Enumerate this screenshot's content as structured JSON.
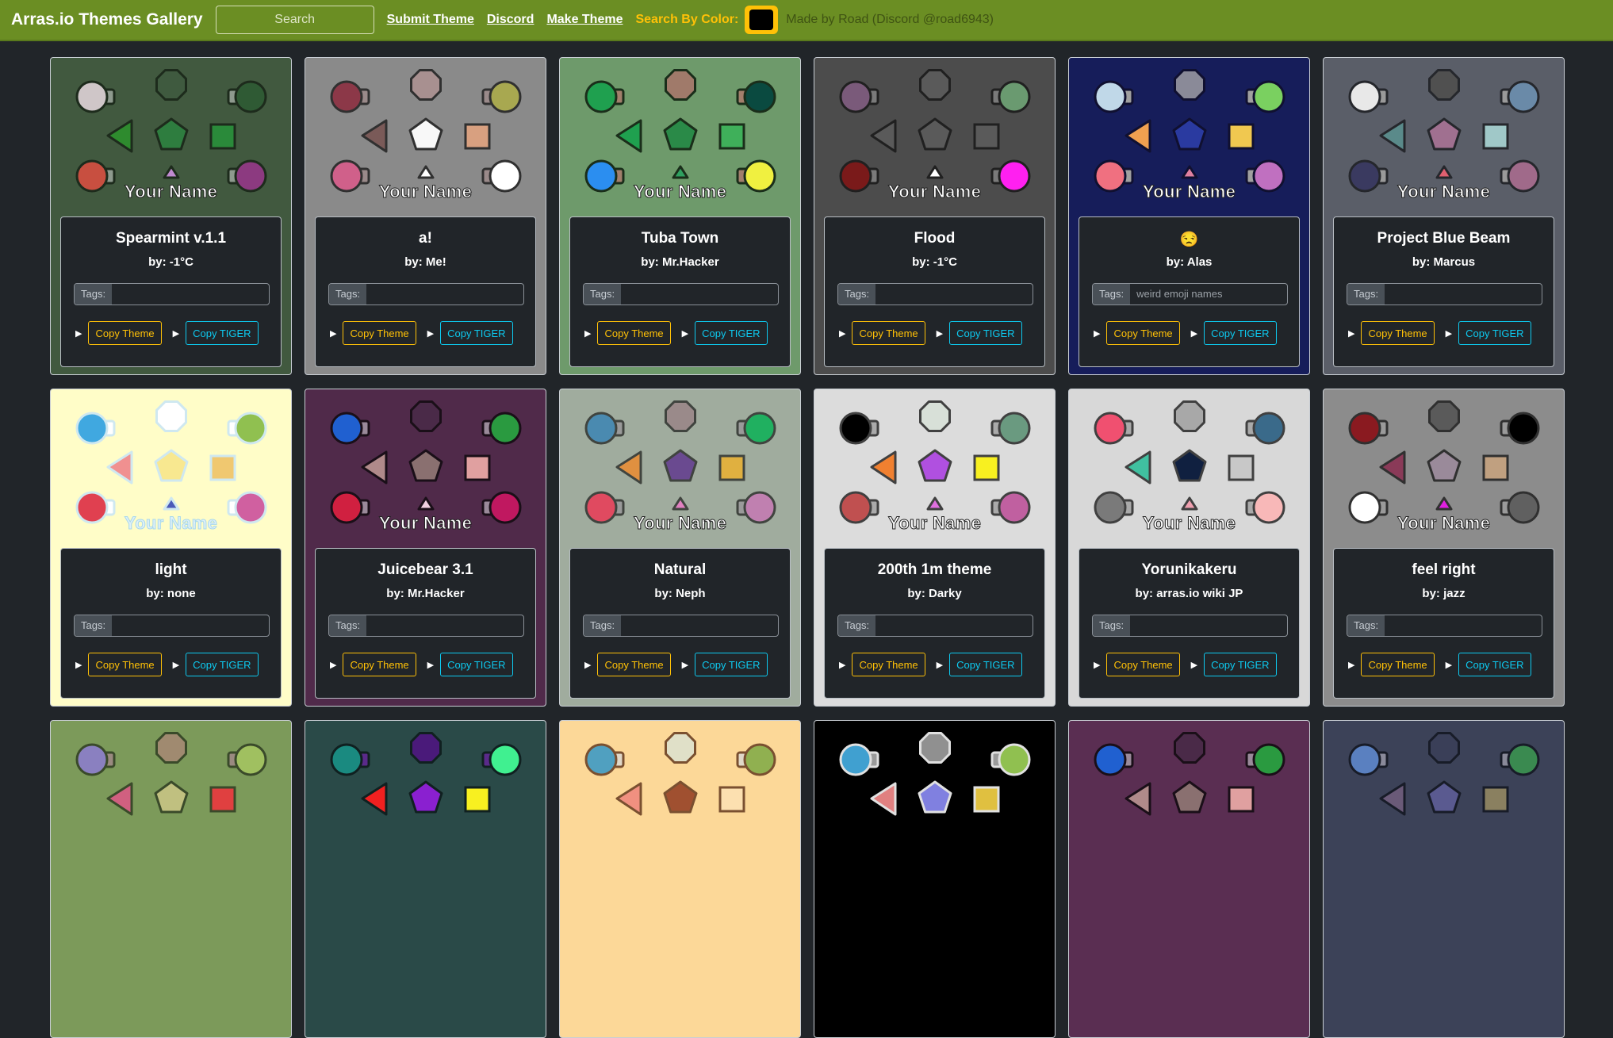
{
  "navbar": {
    "brand": "Arras.io Themes Gallery",
    "search_placeholder": "Search",
    "links": [
      "Submit Theme",
      "Discord",
      "Make Theme"
    ],
    "color_label": "Search By Color:",
    "color_value": "#000000",
    "credit": "Made by Road (Discord @road6943)"
  },
  "labels": {
    "your_name": "Your Name",
    "tags": "Tags:",
    "copy_theme": "Copy Theme",
    "copy_tiger": "Copy TIGER"
  },
  "themes": [
    {
      "name": "Spearmint v.1.1",
      "author": "by: -1°C",
      "tags": "",
      "bg": "#41593f",
      "barrel": "#8e9a8e",
      "border": "#1d2b1c",
      "colors": [
        "#cfc6c8",
        "#3f5a3f",
        "#2f5a34",
        "#2e8b2e",
        "#2e7d3f",
        "#2a8a3a",
        "#c84f40",
        "#c08ad0",
        "#8c3a80"
      ]
    },
    {
      "name": "a!",
      "author": "by: Me!",
      "tags": "",
      "bg": "#8a8a8a",
      "barrel": "#9a8a8a",
      "border": "#303030",
      "colors": [
        "#8c3848",
        "#a89090",
        "#a8a850",
        "#7a5a58",
        "#f8f8f8",
        "#d8a080",
        "#d0608a",
        "#ffffff",
        "#ffffff"
      ]
    },
    {
      "name": "Tuba Town",
      "author": "by: Mr.Hacker",
      "tags": "",
      "bg": "#6e9a6b",
      "barrel": "#a27f6c",
      "border": "#1a2e1a",
      "colors": [
        "#1fa04f",
        "#a07a6a",
        "#0a4a40",
        "#1fa04f",
        "#2a8a48",
        "#3fb05a",
        "#2b8ef0",
        "#2fa060",
        "#f0f040"
      ]
    },
    {
      "name": "Flood",
      "author": "by: -1°C",
      "tags": "",
      "bg": "#4c4c4c",
      "barrel": "#7a7a7a",
      "border": "#202020",
      "colors": [
        "#7a5a7a",
        "#5a5a5a",
        "#6a9a70",
        "#5a5a5a",
        "#5a5a5a",
        "#5a5a5a",
        "#7a1a1a",
        "#ffffff",
        "#ff20f0"
      ]
    },
    {
      "name": "😒",
      "author": "by: Alas",
      "tags": "weird emoji names",
      "bg": "#161d5a",
      "barrel": "#a0a0a0",
      "border": "#101030",
      "colors": [
        "#c0d8e8",
        "#8a8a98",
        "#7ad060",
        "#f0a050",
        "#2a3aa0",
        "#f0c850",
        "#f07080",
        "#e080a0",
        "#c070c0"
      ]
    },
    {
      "name": "Project Blue Beam",
      "author": "by: Marcus",
      "tags": "",
      "bg": "#5a5e68",
      "barrel": "#9a9a9a",
      "border": "#25272c",
      "colors": [
        "#e8e8e8",
        "#505050",
        "#6a8aa8",
        "#5a8a8a",
        "#a07090",
        "#a0c8c8",
        "#3a3a60",
        "#e06070",
        "#a06a8a"
      ]
    },
    {
      "name": "light",
      "author": "by: none",
      "tags": "",
      "bg": "#fffdc8",
      "barrel": "#ffffff",
      "border": "#cfe8f0",
      "colors": [
        "#40a8e0",
        "#ffffff",
        "#90c050",
        "#f09090",
        "#f8e890",
        "#f0c870",
        "#e04050",
        "#4a5ab8",
        "#d060a0"
      ]
    },
    {
      "name": "Juicebear 3.1",
      "author": "by: Mr.Hacker",
      "tags": "",
      "bg": "#502a4a",
      "barrel": "#9a8a9a",
      "border": "#1a0f18",
      "colors": [
        "#2060d0",
        "#4a2a48",
        "#2a9a40",
        "#b08a8a",
        "#8a7070",
        "#e0a0a0",
        "#d02040",
        "#f0d0e0",
        "#c01860"
      ]
    },
    {
      "name": "Natural",
      "author": "by: Neph",
      "tags": "",
      "bg": "#a0ac9e",
      "barrel": "#9a9a9a",
      "border": "#40443f",
      "colors": [
        "#4a8ab0",
        "#9a8a8a",
        "#20b060",
        "#e09040",
        "#6a4a90",
        "#e0b040",
        "#e04a60",
        "#e080c0",
        "#c080b0"
      ]
    },
    {
      "name": "200th 1m theme",
      "author": "by: Darky",
      "tags": "",
      "bg": "#dcdcdc",
      "barrel": "#aaaaaa",
      "border": "#404040",
      "colors": [
        "#000000",
        "#d8e0d8",
        "#6a9a80",
        "#f08030",
        "#b050e0",
        "#f8f020",
        "#c05050",
        "#e070e0",
        "#c060a0"
      ]
    },
    {
      "name": "Yorunikakeru",
      "author": "by: arras.io wiki JP",
      "tags": "",
      "bg": "#d8d8d8",
      "barrel": "#aaaaaa",
      "border": "#404040",
      "colors": [
        "#f05070",
        "#a8a8a8",
        "#3a6a8a",
        "#40c0a0",
        "#102040",
        "#c8c8c8",
        "#7a7a7a",
        "#f0a0b0",
        "#f8b8b8"
      ]
    },
    {
      "name": "feel right",
      "author": "by: jazz",
      "tags": "",
      "bg": "#8c8c8c",
      "barrel": "#9a9a9a",
      "border": "#303030",
      "colors": [
        "#8a1a20",
        "#5a5a5a",
        "#000000",
        "#8a3a58",
        "#9a8a9a",
        "#c0a080",
        "#ffffff",
        "#e020e0",
        "#606060"
      ]
    },
    {
      "name": "",
      "author": "",
      "tags": "",
      "bg": "#7c9a5a",
      "barrel": "#9a8a80",
      "border": "#3a4a2a",
      "colors": [
        "#8a80c0",
        "#a08a70",
        "#a0c060",
        "#d06080",
        "#c0c080",
        "#e04040"
      ]
    },
    {
      "name": "",
      "author": "",
      "tags": "",
      "bg": "#2a4a48",
      "barrel": "#5a2a8a",
      "border": "#102020",
      "colors": [
        "#1a8a80",
        "#4a1a7a",
        "#40f090",
        "#f02020",
        "#8a20d0",
        "#f8f020"
      ]
    },
    {
      "name": "",
      "author": "",
      "tags": "",
      "bg": "#fcd898",
      "barrel": "#e0d8c8",
      "border": "#7a5030",
      "colors": [
        "#50a0c0",
        "#e0e0c8",
        "#90b050",
        "#f09080",
        "#a05030",
        "#fce0b0"
      ]
    },
    {
      "name": "",
      "author": "",
      "tags": "",
      "bg": "#000000",
      "barrel": "#9a9a9a",
      "border": "#e0e0e0",
      "colors": [
        "#40a0d0",
        "#909090",
        "#90c050",
        "#e08080",
        "#8080e0",
        "#e0c040"
      ]
    },
    {
      "name": "",
      "author": "",
      "tags": "",
      "bg": "#5a2e52",
      "barrel": "#9a8a9a",
      "border": "#1a0f18",
      "colors": [
        "#2060d0",
        "#4a2a48",
        "#2a9a40",
        "#b08a8a",
        "#8a7070",
        "#e0a0a0"
      ]
    },
    {
      "name": "",
      "author": "",
      "tags": "",
      "bg": "#3c4258",
      "barrel": "#8a8a9a",
      "border": "#181c28",
      "colors": [
        "#5a80c0",
        "#3a3f58",
        "#3a8a50",
        "#6a5a78",
        "#5a5a90",
        "#8a8060"
      ]
    }
  ]
}
